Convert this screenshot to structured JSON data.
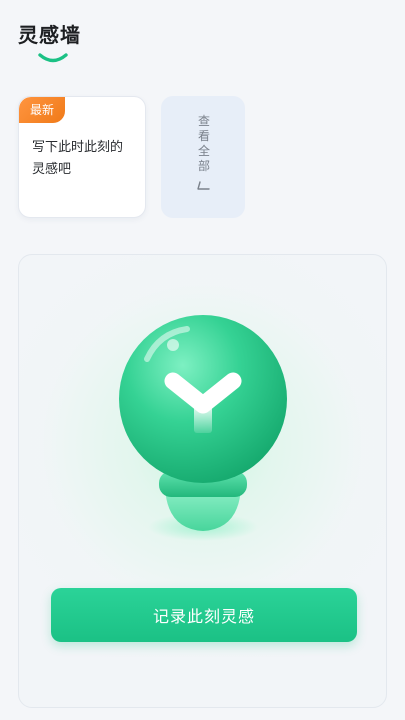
{
  "header": {
    "title": "灵感墙"
  },
  "latest_card": {
    "badge": "最新",
    "prompt": "写下此时此刻的灵感吧"
  },
  "view_all": {
    "label": "查看全部"
  },
  "main": {
    "record_button_label": "记录此刻灵感"
  },
  "colors": {
    "accent_green": "#1bc185",
    "badge_orange": "#f07a18",
    "page_background": "#f4f6f9"
  },
  "icons": {
    "title_underline": "smile-curve-icon",
    "view_all_arrow": "arrow-icon",
    "hero": "lightbulb-icon"
  }
}
